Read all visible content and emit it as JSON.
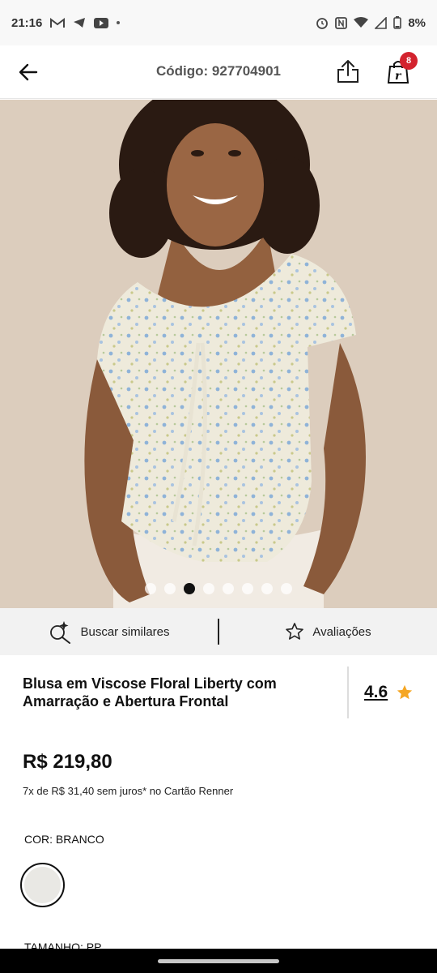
{
  "status_bar": {
    "time": "21:16",
    "battery": "8%",
    "left_icons": [
      "gmail-icon",
      "telegram-icon",
      "youtube-icon",
      "dot-icon"
    ],
    "right_icons": [
      "alarm-icon",
      "nfc-icon",
      "wifi-icon",
      "signal-icon",
      "battery-icon"
    ]
  },
  "header": {
    "title": "Código: 927704901",
    "cart_count": "8"
  },
  "gallery": {
    "dots_total": 8,
    "active_index": 2
  },
  "actions": {
    "similar_label": "Buscar similares",
    "reviews_label": "Avaliações"
  },
  "product": {
    "title": "Blusa em Viscose Floral Liberty com Amarração e Abertura Frontal",
    "rating": "4.6",
    "price": "R$ 219,80",
    "installments": "7x de R$ 31,40 sem juros* no Cartão Renner",
    "color_label": "COR: BRANCO",
    "size_label": "TAMANHO: PP"
  },
  "colors": {
    "star": "#f5a623",
    "badge": "#d3232e",
    "swatch": "#e9e8e4"
  }
}
